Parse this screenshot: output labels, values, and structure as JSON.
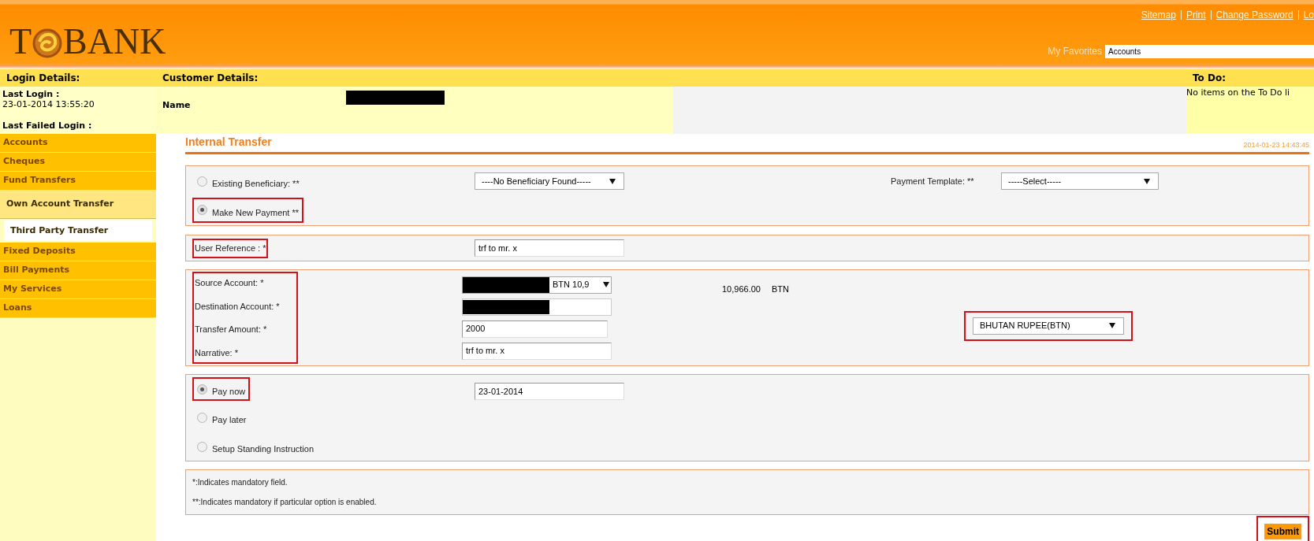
{
  "header": {
    "logo": {
      "left": "T",
      "right": "BANK"
    },
    "links": [
      "Sitemap",
      "Print",
      "Change Password",
      "Lo"
    ],
    "favorites": {
      "label": "My Favorites",
      "value": "Accounts"
    }
  },
  "login": {
    "title": "Login Details:",
    "last_login_label": "Last Login :",
    "last_login_value": "23-01-2014 13:55:20",
    "last_failed_label": "Last Failed Login :"
  },
  "customer": {
    "title": "Customer Details:",
    "name_label": "Name"
  },
  "todo": {
    "title": "To Do:",
    "text": "No items on the To Do li"
  },
  "sidebar": {
    "items": [
      {
        "label": "Accounts",
        "kind": "main",
        "selected": false
      },
      {
        "label": "Cheques",
        "kind": "main",
        "selected": false
      },
      {
        "label": "Fund Transfers",
        "kind": "main",
        "selected": false
      },
      {
        "label": "Own Account Transfer",
        "kind": "sub",
        "selected": false
      },
      {
        "label": "Third Party Transfer",
        "kind": "sub",
        "selected": true
      },
      {
        "label": "Fixed Deposits",
        "kind": "main",
        "selected": false
      },
      {
        "label": "Bill Payments",
        "kind": "main",
        "selected": false
      },
      {
        "label": "My Services",
        "kind": "main",
        "selected": false
      },
      {
        "label": "Loans",
        "kind": "main",
        "selected": false
      }
    ]
  },
  "form": {
    "title": "Internal Transfer",
    "timestamp": "2014-01-23 14:43:45",
    "payment_type": [
      {
        "label": "Existing Beneficiary: **",
        "selected": false,
        "highlighted": false
      },
      {
        "label": "Make New Payment **",
        "selected": true,
        "highlighted": true
      }
    ],
    "beneficiary_select": "----No Beneficiary Found-----",
    "template": {
      "label": "Payment Template: **",
      "value": "-----Select-----"
    },
    "user_reference": {
      "label": "User Reference : *",
      "value": "trf to mr. x",
      "highlighted": true
    },
    "source_account": {
      "label": "Source Account: *",
      "value": "BTN 10,9"
    },
    "destination_account": {
      "label": "Destination Account: *"
    },
    "transfer_amount": {
      "label": "Transfer Amount: *",
      "value": "2000"
    },
    "narrative": {
      "label": "Narrative: *",
      "value": "trf to mr. x"
    },
    "balance": {
      "amount": "10,966.00",
      "currency": "BTN"
    },
    "currency_select": {
      "value": "BHUTAN RUPEE(BTN)",
      "highlighted": true
    },
    "schedule": [
      {
        "label": "Pay now",
        "selected": true,
        "highlighted": true
      },
      {
        "label": "Pay later",
        "selected": false,
        "highlighted": false
      },
      {
        "label": "Setup Standing Instruction",
        "selected": false,
        "highlighted": false
      }
    ],
    "date": "23-01-2014",
    "notes": [
      "*:Indicates mandatory field.",
      "**:Indicates mandatory if particular option is enabled."
    ],
    "submit": {
      "label": "Submit",
      "highlighted": true
    }
  }
}
